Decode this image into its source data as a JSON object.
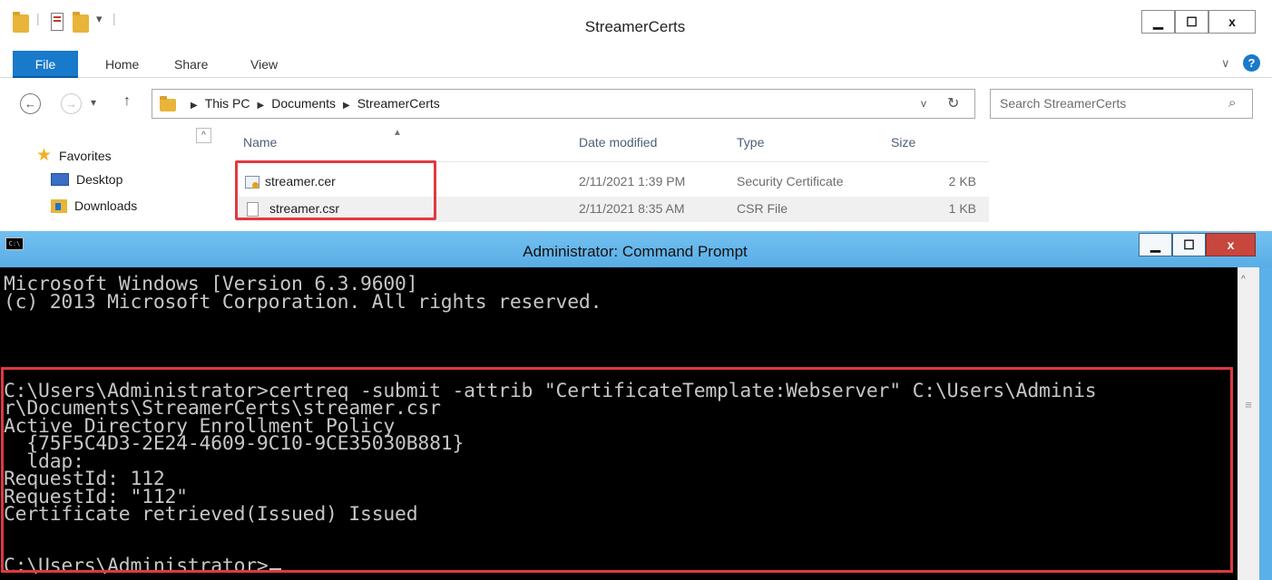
{
  "explorer": {
    "title": "StreamerCerts",
    "quick_access_icons": [
      "folder-icon",
      "properties-icon",
      "new-folder-icon",
      "customize-dropdown-icon"
    ],
    "window_buttons": {
      "minimize": "▁",
      "maximize": "☐",
      "close": "x"
    },
    "ribbon": {
      "tabs": [
        "File",
        "Home",
        "Share",
        "View"
      ],
      "expand_icon": "chevron-down-icon",
      "help_icon": "?"
    },
    "nav": {
      "back": "←",
      "forward": "→",
      "recent": "▾",
      "up": "↑"
    },
    "address": {
      "segments": [
        "This PC",
        "Documents",
        "StreamerCerts"
      ],
      "separator": "▶",
      "dropdown": "v",
      "refresh": "↻"
    },
    "search": {
      "placeholder": "Search StreamerCerts",
      "icon": "⌕"
    },
    "nav_pane": {
      "favorites_label": "Favorites",
      "items": [
        "Desktop",
        "Downloads"
      ]
    },
    "columns": {
      "name": "Name",
      "date_modified": "Date modified",
      "type": "Type",
      "size": "Size"
    },
    "files": [
      {
        "name": "streamer.cer",
        "date": "2/11/2021 1:39 PM",
        "type": "Security Certificate",
        "size": "2 KB",
        "icon": "certificate-icon"
      },
      {
        "name": "streamer.csr",
        "date": "2/11/2021 8:35 AM",
        "type": "CSR File",
        "size": "1 KB",
        "icon": "file-icon"
      }
    ],
    "highlight_color": "#e0393f"
  },
  "cmd": {
    "title": "Administrator: Command Prompt",
    "icon_text": "C:\\",
    "window_buttons": {
      "minimize": "▁",
      "maximize": "☐",
      "close": "x"
    },
    "lines": [
      "Microsoft Windows [Version 6.3.9600]",
      "(c) 2013 Microsoft Corporation. All rights reserved.",
      "",
      "C:\\Users\\Administrator>certreq -submit -attrib \"CertificateTemplate:Webserver\" C:\\Users\\Adminis",
      "r\\Documents\\StreamerCerts\\streamer.csr",
      "Active Directory Enrollment Policy",
      "  {75F5C4D3-2E24-4609-9C10-9CE35030B881}",
      "  ldap:",
      "RequestId: 112",
      "RequestId: \"112\"",
      "Certificate retrieved(Issued) Issued",
      "",
      "C:\\Users\\Administrator>"
    ],
    "scroll_up": "^",
    "scroll_grip": "≡",
    "highlight_color": "#e0393f",
    "background": "#000000",
    "text_color": "#c6c6c6",
    "titlebar_color": "#5ab0e8"
  }
}
